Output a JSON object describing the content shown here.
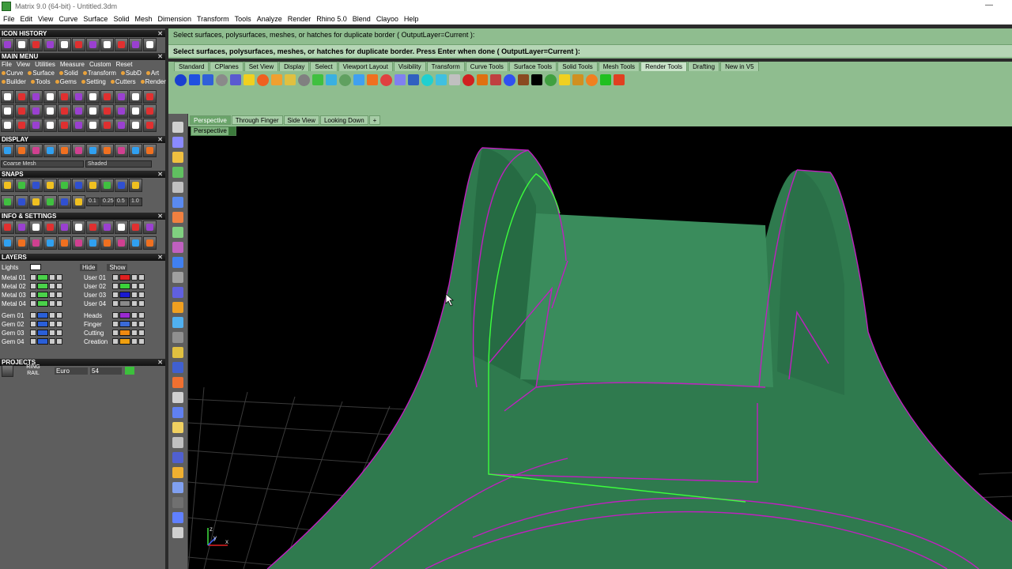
{
  "window": {
    "title": "Matrix 9.0 (64-bit) - Untitled.3dm",
    "minimize": "—"
  },
  "menu": [
    "File",
    "Edit",
    "View",
    "Curve",
    "Surface",
    "Solid",
    "Mesh",
    "Dimension",
    "Transform",
    "Tools",
    "Analyze",
    "Render",
    "Rhino 5.0",
    "Blend",
    "Clayoo",
    "Help"
  ],
  "panel": {
    "icon_history": "ICON HISTORY",
    "main_menu": "MAIN MENU",
    "main_menu_row1": [
      "File",
      "View",
      "Utilities",
      "Measure",
      "Custom",
      "Reset"
    ],
    "main_menu_row2": [
      "Curve",
      "Surface",
      "Solid",
      "Transform",
      "SubD",
      "Art"
    ],
    "main_menu_row3": [
      "Builder",
      "Tools",
      "Gems",
      "Setting",
      "Cutters",
      "Render"
    ],
    "display": "DISPLAY",
    "display_mode1": "Coarse Mesh",
    "display_mode2": "Shaded",
    "snaps": "SNAPS",
    "snap_values": [
      "0.1",
      "0.25",
      "0.5",
      "1.0"
    ],
    "info_settings": "INFO & SETTINGS",
    "layers": "LAYERS",
    "lights_label": "Lights",
    "hide_label": "Hide",
    "show_label": "Show",
    "layers_left": [
      {
        "name": "Metal 01",
        "color": "#4ad24a"
      },
      {
        "name": "Metal 02",
        "color": "#4ad24a"
      },
      {
        "name": "Metal 03",
        "color": "#4ad24a"
      },
      {
        "name": "Metal 04",
        "color": "#4ad24a"
      },
      {
        "name": "Gem 01",
        "color": "#2a5fd8"
      },
      {
        "name": "Gem 02",
        "color": "#2a5fd8"
      },
      {
        "name": "Gem 03",
        "color": "#2a5fd8"
      },
      {
        "name": "Gem 04",
        "color": "#2a5fd8"
      }
    ],
    "layers_right": [
      {
        "name": "User 01",
        "color": "#e02020"
      },
      {
        "name": "User 02",
        "color": "#3ad23a"
      },
      {
        "name": "User 03",
        "color": "#1a1ad0"
      },
      {
        "name": "User 04",
        "color": "#8a8a8a"
      },
      {
        "name": "Heads",
        "color": "#9a2ad0"
      },
      {
        "name": "Finger",
        "color": "#3a6ad8"
      },
      {
        "name": "Cutting",
        "color": "#f08a10"
      },
      {
        "name": "Creation",
        "color": "#f0a010"
      }
    ],
    "projects": "PROJECTS",
    "project_name1": "RING",
    "project_name2": "RAIL",
    "project_sizing": "Euro",
    "project_size": "54"
  },
  "command": {
    "history": "Select surfaces, polysurfaces, meshes, or hatches for duplicate border ( OutputLayer=Current ):",
    "prompt": "Select surfaces, polysurfaces, meshes, or hatches for duplicate border. Press Enter when done ( OutputLayer=Current ):"
  },
  "tool_tabs": [
    "Standard",
    "CPlanes",
    "Set View",
    "Display",
    "Select",
    "Viewport Layout",
    "Visibility",
    "Transform",
    "Curve Tools",
    "Surface Tools",
    "Solid Tools",
    "Mesh Tools",
    "Render Tools",
    "Drafting",
    "New in V5"
  ],
  "active_tool_tab": "Render Tools",
  "viewport_tabs": [
    "Perspective",
    "Through Finger",
    "Side View",
    "Looking Down",
    "+"
  ],
  "active_viewport": "Perspective",
  "viewport_title": "Perspective",
  "axis": {
    "x": "x",
    "y": "y",
    "z": "z"
  },
  "colors": {
    "accent": "#8fbd8f",
    "model": "#2f7a4e",
    "edge": "#c020c0",
    "selected": "#3cff3c"
  }
}
